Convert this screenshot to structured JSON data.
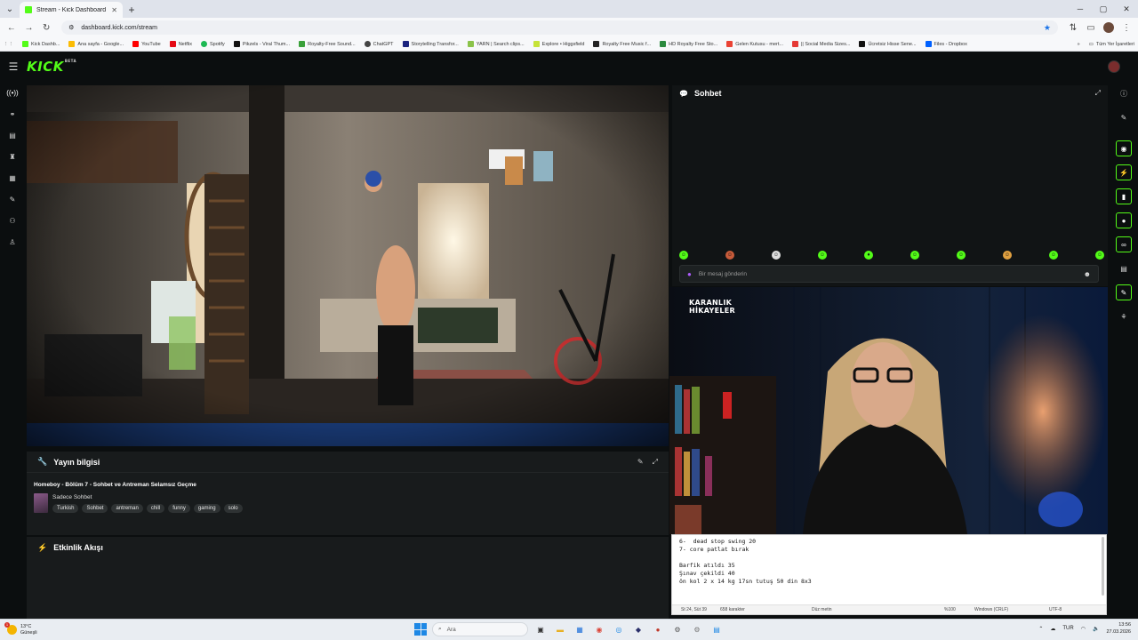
{
  "browser": {
    "tab_title": "Stream - Kick Dashboard",
    "url": "dashboard.kick.com/stream",
    "new_tab": "+",
    "bookmarks": [
      {
        "label": "Kick Dashb...",
        "color": "#53fc18"
      },
      {
        "label": "Ana sayfa - Google...",
        "color": "#fbbc05"
      },
      {
        "label": "YouTube",
        "color": "#ff0000"
      },
      {
        "label": "Netflix",
        "color": "#e50914"
      },
      {
        "label": "Spotify",
        "color": "#1db954"
      },
      {
        "label": "Pikzels - Viral Thum...",
        "color": "#111111"
      },
      {
        "label": "Royalty-Free Sound...",
        "color": "#3aa13a"
      },
      {
        "label": "ChatGPT",
        "color": "#444444"
      },
      {
        "label": "Storytelling Transfor...",
        "color": "#1a237e"
      },
      {
        "label": "YARN | Search clips...",
        "color": "#8bc34a"
      },
      {
        "label": "Explore • Higgsfield",
        "color": "#c6e339"
      },
      {
        "label": "Royalty Free Music f...",
        "color": "#222222"
      },
      {
        "label": "HD Royalty Free Sto...",
        "color": "#2b8a3e"
      },
      {
        "label": "Gelen Kutusu - mert...",
        "color": "#ea4335"
      },
      {
        "label": "|| Social Media Sizes...",
        "color": "#e53935"
      },
      {
        "label": "Ücretsiz Hisse Sene...",
        "color": "#111111"
      },
      {
        "label": "Files - Dropbox",
        "color": "#0061ff"
      }
    ],
    "all_bookmarks": "Tüm Yer İşaretleri"
  },
  "kick": {
    "logo": "KICK",
    "logo_sup": "BETA",
    "chat": {
      "title": "Sohbet",
      "input_placeholder": "Bir mesaj gönderin"
    },
    "stream_info": {
      "title": "Yayın bilgisi",
      "stream_title": "Homeboy - Bölüm 7 - Sohbet ve Antreman Selamsız Geçme",
      "category": "Sadece Sohbet",
      "tags": [
        "Turkish",
        "Sohbet",
        "antreman",
        "chill",
        "funny",
        "gaming",
        "solo"
      ]
    },
    "activity": {
      "title": "Etkinlik Akışı"
    },
    "left_rail_icons": [
      "stream-icon",
      "link-icon",
      "analytics-icon",
      "trophy-icon",
      "media-icon",
      "wrench-icon",
      "community-icon",
      "creator-icon"
    ],
    "right_rail_icons": [
      "info-icon",
      "pencil-icon",
      "camera-icon",
      "bolt-icon",
      "cup-icon",
      "chat-bubble-icon",
      "connection-icon",
      "library-icon",
      "tool-icon",
      "share-icon"
    ]
  },
  "side_video": {
    "brand_line1": "KARANLIK",
    "brand_line2": "HİKAYELER"
  },
  "notepad": {
    "lines": [
      "6-  dead stop swing 20",
      "7- core patlat bırak",
      "",
      "Barfik atıldı 35",
      "Şınav çekildi 40",
      "ön kol 2 x 14 kg 17sn tutuş 50 din 8x3"
    ],
    "status": {
      "position": "St 24, Süt 39",
      "chars": "658 karakter",
      "format": "Düz metin",
      "zoom": "%100",
      "line_ending": "Windows (CRLF)",
      "encoding": "UTF-8"
    }
  },
  "taskbar": {
    "weather_temp": "13°C",
    "weather_desc": "Güneşli",
    "search_placeholder": "Ara",
    "lang": "TUR",
    "time": "13:56",
    "date": "27.03.2026"
  },
  "colors": {
    "kick_green": "#53fc18",
    "panel_bg": "#181b1c",
    "app_bg": "#0b0e0f"
  }
}
